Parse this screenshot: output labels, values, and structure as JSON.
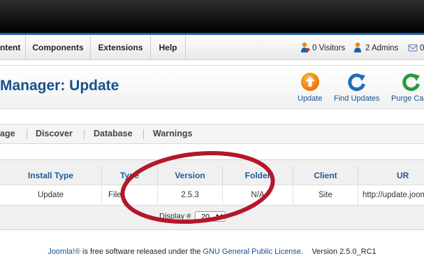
{
  "menu": {
    "items": [
      {
        "label": "ntent"
      },
      {
        "label": "Components"
      },
      {
        "label": "Extensions"
      },
      {
        "label": "Help"
      }
    ]
  },
  "status": {
    "visitors": "0 Visitors",
    "admins": "2 Admins",
    "messages": "0"
  },
  "header": {
    "title": "Manager: Update",
    "buttons": [
      {
        "label": "Update",
        "icon": "update-icon"
      },
      {
        "label": "Find Updates",
        "icon": "refresh-icon"
      },
      {
        "label": "Purge Cac",
        "icon": "refresh-icon"
      }
    ]
  },
  "subnav": {
    "items": [
      {
        "label": "age"
      },
      {
        "label": "Discover"
      },
      {
        "label": "Database"
      },
      {
        "label": "Warnings"
      }
    ]
  },
  "table": {
    "columns": [
      "Install Type",
      "Type",
      "Version",
      "Folder",
      "Client",
      "UR"
    ],
    "rows": [
      {
        "install_type": "Update",
        "type": "File",
        "version": "2.5.3",
        "folder": "N/A",
        "client": "Site",
        "url": "http://update.jooml"
      }
    ],
    "display_label": "Display #",
    "display_value": "20"
  },
  "footer": {
    "joomla_link": "Joomla!®",
    "text_mid": " is free software released under the ",
    "license_link": "GNU General Public License",
    "version_text": ".    Version 2.5.0_RC1"
  },
  "colors": {
    "accent_blue": "#15518f",
    "annotation_red": "#b5172a"
  }
}
